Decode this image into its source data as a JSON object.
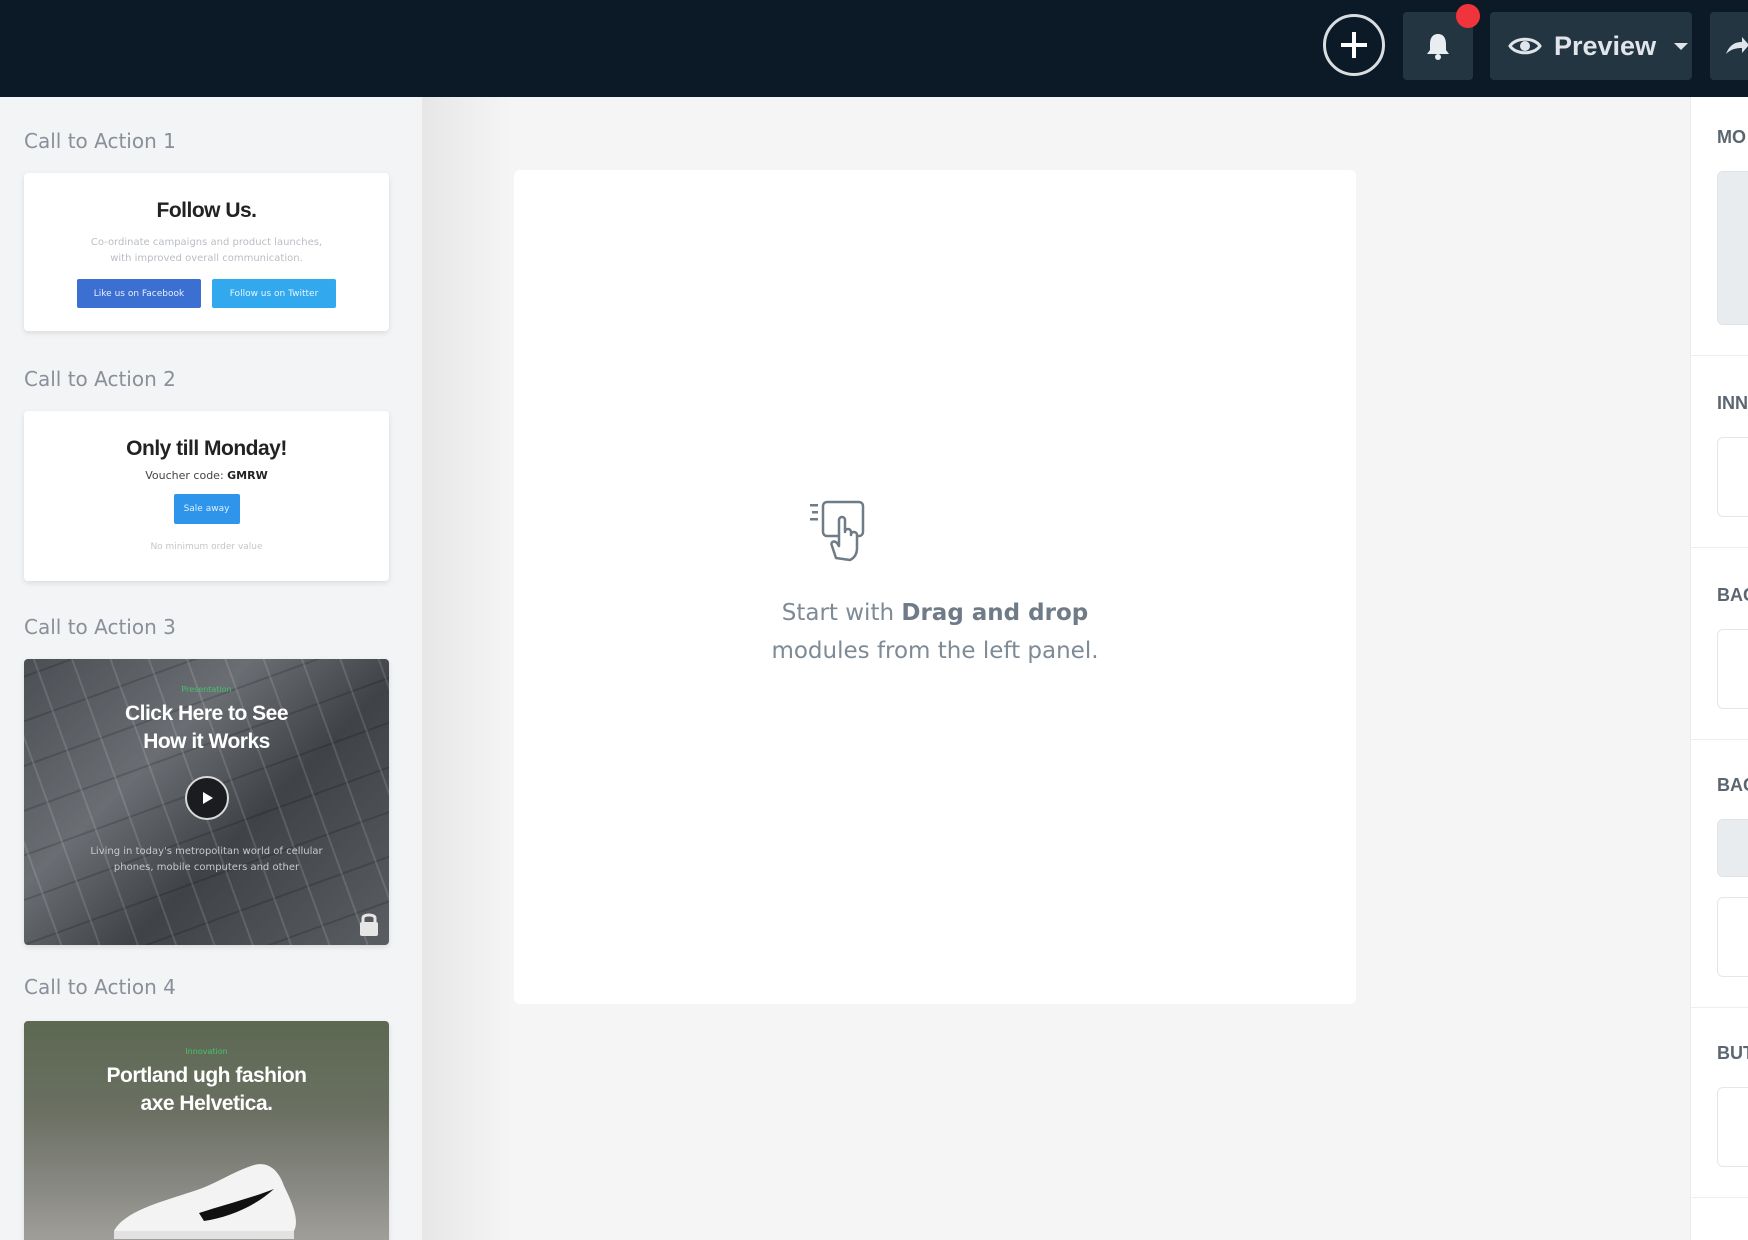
{
  "topbar": {
    "preview_label": "Preview",
    "accent_notification": "#f0343c",
    "background": "#0b1a26"
  },
  "sidebar": {
    "sections": [
      {
        "label": "Call to Action 1",
        "title": "Follow Us.",
        "description": "Co-ordinate campaigns and product launches, with improved overall communication.",
        "button_facebook": "Like us on Facebook",
        "button_twitter": "Follow us on Twitter"
      },
      {
        "label": "Call to Action 2",
        "title": "Only till Monday!",
        "voucher_prefix": "Voucher code:",
        "voucher_code": "GMRW",
        "button": "Sale away",
        "note": "No minimum order value"
      },
      {
        "label": "Call to Action 3",
        "kicker": "Presentation",
        "title_line1": "Click Here to See",
        "title_line2": "How it Works",
        "description": "Living in today's metropolitan world of cellular phones, mobile computers and other"
      },
      {
        "label": "Call to Action 4",
        "kicker": "Innovation",
        "title_line1": "Portland ugh fashion",
        "title_line2": "axe Helvetica."
      }
    ]
  },
  "canvas": {
    "hint_prefix": "Start with ",
    "hint_bold": "Drag and drop",
    "hint_line2": "modules from the left panel."
  },
  "rightpanel": {
    "labels": [
      "MO",
      "INN",
      "BAC",
      "BAC",
      "BUT"
    ]
  },
  "icons": {
    "add": "plus-icon",
    "bell": "bell-icon",
    "preview": "eye-icon",
    "share": "share-arrow-icon",
    "drag": "drag-drop-hand-icon",
    "play": "play-icon",
    "lock": "lock-icon"
  }
}
